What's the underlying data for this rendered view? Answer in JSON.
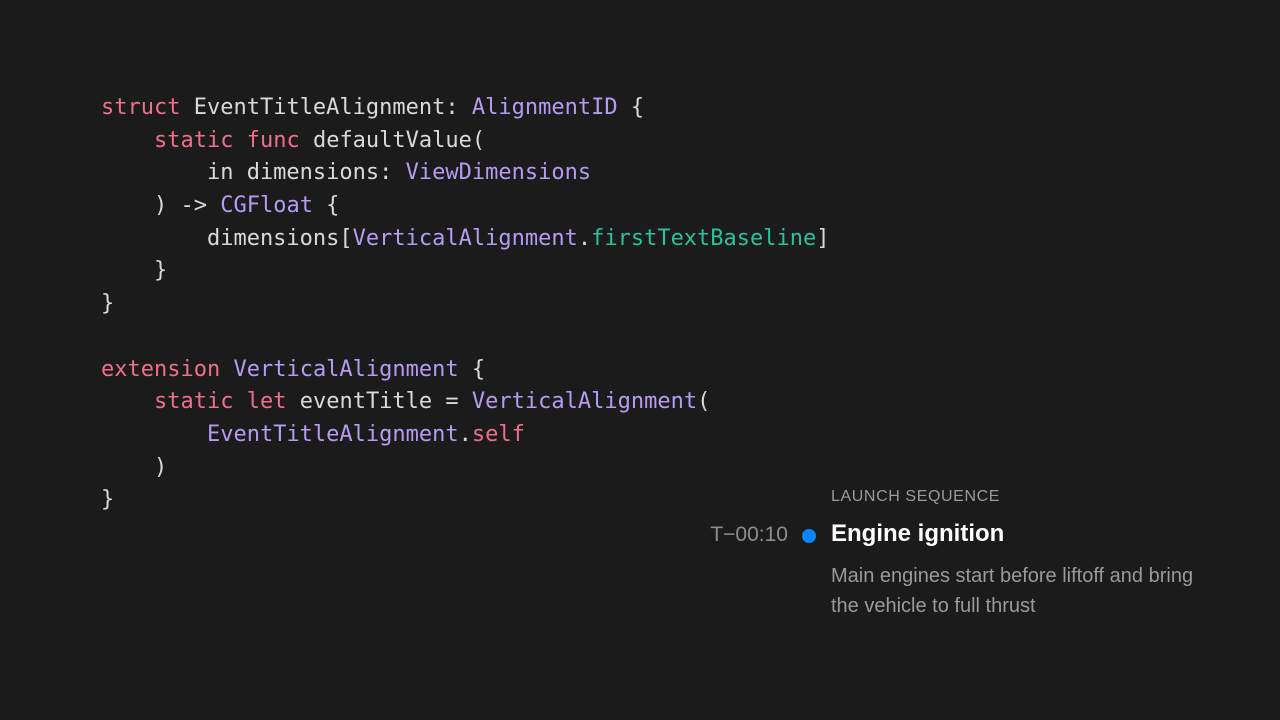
{
  "code": {
    "lines": [
      [
        {
          "t": "struct",
          "k": "keyword"
        },
        {
          "t": " EventTitleAlignment: ",
          "k": "plain"
        },
        {
          "t": "AlignmentID",
          "k": "type"
        },
        {
          "t": " {",
          "k": "plain"
        }
      ],
      [
        {
          "t": "    ",
          "k": "plain"
        },
        {
          "t": "static",
          "k": "keyword"
        },
        {
          "t": " ",
          "k": "plain"
        },
        {
          "t": "func",
          "k": "keyword"
        },
        {
          "t": " defaultValue(",
          "k": "plain"
        }
      ],
      [
        {
          "t": "        in dimensions: ",
          "k": "plain"
        },
        {
          "t": "ViewDimensions",
          "k": "type"
        }
      ],
      [
        {
          "t": "    ) -> ",
          "k": "plain"
        },
        {
          "t": "CGFloat",
          "k": "type"
        },
        {
          "t": " {",
          "k": "plain"
        }
      ],
      [
        {
          "t": "        dimensions[",
          "k": "plain"
        },
        {
          "t": "VerticalAlignment",
          "k": "type"
        },
        {
          "t": ".",
          "k": "plain"
        },
        {
          "t": "firstTextBaseline",
          "k": "member"
        },
        {
          "t": "]",
          "k": "plain"
        }
      ],
      [
        {
          "t": "    }",
          "k": "plain"
        }
      ],
      [
        {
          "t": "}",
          "k": "plain"
        }
      ],
      [
        {
          "t": "",
          "k": "plain"
        }
      ],
      [
        {
          "t": "extension",
          "k": "keyword"
        },
        {
          "t": " ",
          "k": "plain"
        },
        {
          "t": "VerticalAlignment",
          "k": "type"
        },
        {
          "t": " {",
          "k": "plain"
        }
      ],
      [
        {
          "t": "    ",
          "k": "plain"
        },
        {
          "t": "static",
          "k": "keyword"
        },
        {
          "t": " ",
          "k": "plain"
        },
        {
          "t": "let",
          "k": "keyword"
        },
        {
          "t": " eventTitle = ",
          "k": "plain"
        },
        {
          "t": "VerticalAlignment",
          "k": "type"
        },
        {
          "t": "(",
          "k": "plain"
        }
      ],
      [
        {
          "t": "        ",
          "k": "plain"
        },
        {
          "t": "EventTitleAlignment",
          "k": "type"
        },
        {
          "t": ".",
          "k": "plain"
        },
        {
          "t": "self",
          "k": "keyword"
        }
      ],
      [
        {
          "t": "    )",
          "k": "plain"
        }
      ],
      [
        {
          "t": "}",
          "k": "plain"
        }
      ]
    ]
  },
  "event": {
    "section": "LAUNCH SEQUENCE",
    "time": "T−00:10",
    "title": "Engine ignition",
    "description": "Main engines start before liftoff and bring the vehicle to full thrust"
  },
  "colors": {
    "background": "#1b1b1b",
    "keyword": "#f06e8c",
    "type": "#b49cf3",
    "member": "#29c29a",
    "accent_dot": "#0a84ff"
  }
}
